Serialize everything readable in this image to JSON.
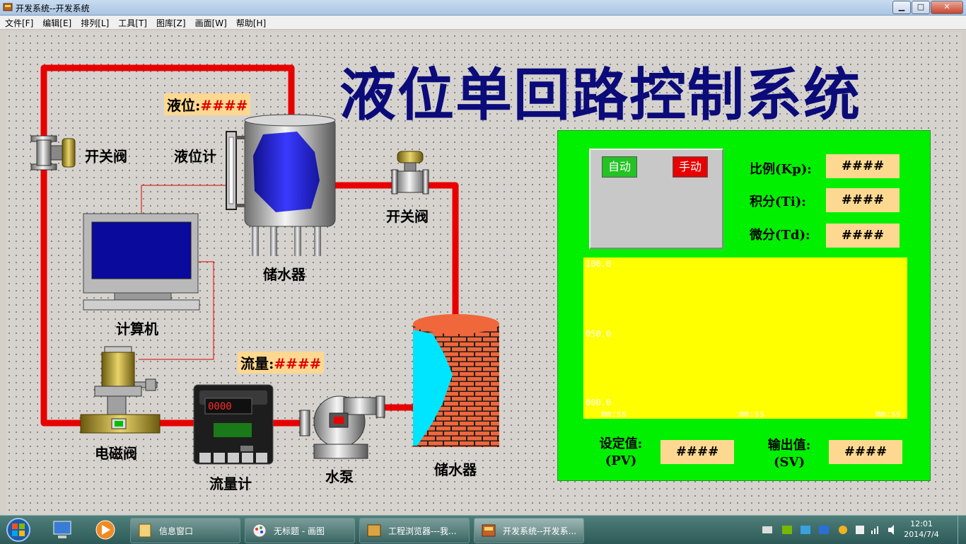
{
  "window": {
    "title": "开发系统--开发系统",
    "min_label": "▁",
    "max_label": "□",
    "close_label": "✕"
  },
  "menu": [
    "文件[F]",
    "编辑[E]",
    "排列[L]",
    "工具[T]",
    "图库[Z]",
    "画面[W]",
    "帮助[H]"
  ],
  "main_title": "液位单回路控制系统",
  "labels": {
    "valve_left": "开关阀",
    "valve_right": "开关阀",
    "level_gauge": "液位计",
    "tank_top": "储水器",
    "computer": "计算机",
    "solenoid_valve": "电磁阀",
    "flowmeter": "流量计",
    "pump": "水泵",
    "tank_bottom": "储水器"
  },
  "readouts": {
    "level_label": "液位:",
    "level_value": "####",
    "flow_label": "流量:",
    "flow_value": "####"
  },
  "flowmeter_display": "0000",
  "control": {
    "auto_label": "自动",
    "manual_label": "手动",
    "kp_label": "比例(Kp):",
    "kp_value": "####",
    "ti_label": "积分(Ti):",
    "ti_value": "####",
    "td_label": "微分(Td):",
    "td_value": "####",
    "sv_label_1": "设定值:",
    "sv_label_2": "(PV)",
    "sv_value": "####",
    "out_label_1": "输出值:",
    "out_label_2": "(SV)",
    "out_value": "####"
  },
  "trend": {
    "y_ticks": [
      "100.0",
      "050.0",
      "000.0"
    ],
    "x_ticks": [
      "mm:ss",
      "mm:ss",
      "mm:ss"
    ]
  },
  "taskbar": {
    "items": [
      "信息窗口",
      "无标题 - 画图",
      "工程浏览器---我...",
      "开发系统--开发系..."
    ],
    "time": "12:01",
    "date": "2014/7/4"
  },
  "colors": {
    "pipe": "#e80000",
    "panel": "#00f000",
    "trend_frame": "#ffff00",
    "trend_bg": "#7a7a7a",
    "title": "#0b0b7a",
    "readout_bg": "#fdd890"
  }
}
